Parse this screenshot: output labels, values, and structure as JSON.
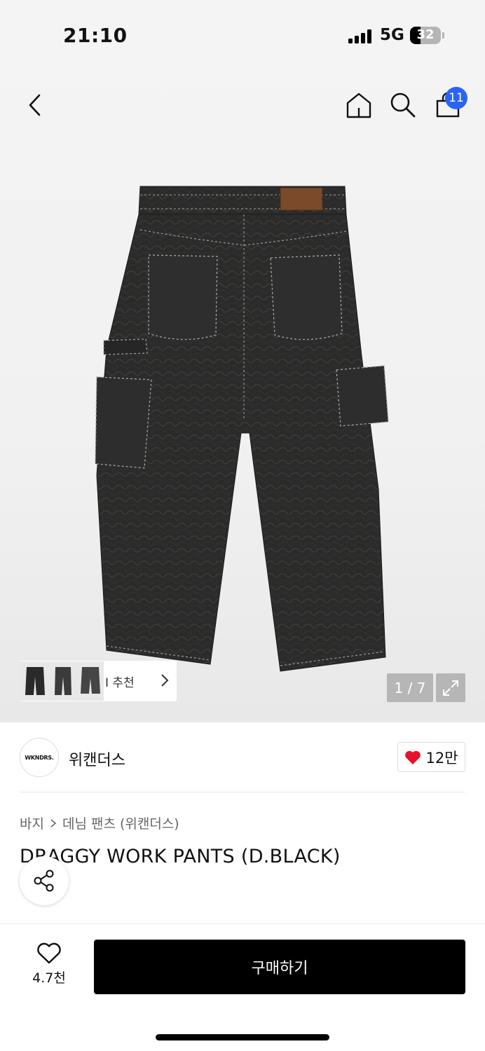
{
  "status": {
    "time": "21:10",
    "network": "5G",
    "battery": "32"
  },
  "nav": {
    "cart_count": "11"
  },
  "gallery": {
    "ai_label": "AI 추천",
    "ai_label_visible": "I 추천",
    "counter": "1 / 7"
  },
  "brand": {
    "logo_text": "WKNDRS.",
    "name": "위캔더스",
    "likes": "12만"
  },
  "product": {
    "breadcrumb": [
      "바지",
      "데님 팬츠 (위캔더스)"
    ],
    "title": "DRAGGY WORK PANTS (D.BLACK)"
  },
  "bottom": {
    "wish_count": "4.7천",
    "buy_label": "구매하기"
  },
  "colors": {
    "accent_badge": "#2b63f6",
    "heart": "#e8112d",
    "buy_button": "#000000"
  }
}
